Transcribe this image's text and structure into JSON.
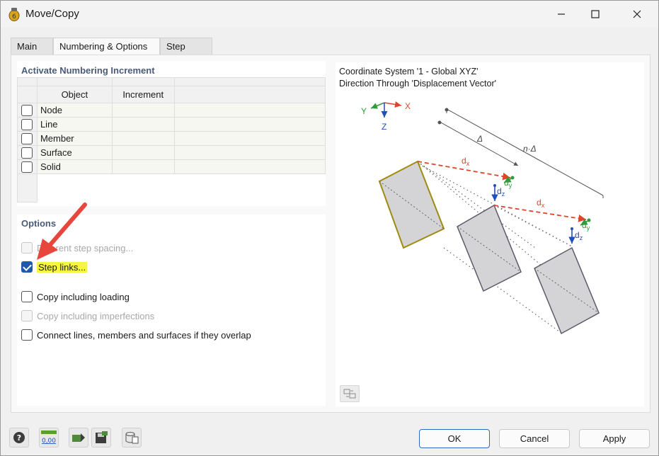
{
  "window": {
    "title": "Move/Copy"
  },
  "tabs": [
    {
      "label": "Main"
    },
    {
      "label": "Numbering & Options"
    },
    {
      "label": "Step Links"
    }
  ],
  "numbering": {
    "title": "Activate Numbering Increment",
    "headers": {
      "object": "Object",
      "increment": "Increment"
    },
    "rows": [
      {
        "label": "Node",
        "checked": false
      },
      {
        "label": "Line",
        "checked": false
      },
      {
        "label": "Member",
        "checked": false
      },
      {
        "label": "Surface",
        "checked": false
      },
      {
        "label": "Solid",
        "checked": false
      }
    ]
  },
  "options": {
    "title": "Options",
    "items": [
      {
        "label": "Different step spacing...",
        "checked": false,
        "disabled": true
      },
      {
        "label": "Step links...",
        "checked": true,
        "disabled": false,
        "highlighted": true
      },
      {
        "label": "Copy including loading",
        "checked": false,
        "disabled": false
      },
      {
        "label": "Copy including imperfections",
        "checked": false,
        "disabled": true
      },
      {
        "label": "Connect lines, members and surfaces if they overlap",
        "checked": false,
        "disabled": false
      }
    ]
  },
  "preview": {
    "line1": "Coordinate System '1 - Global XYZ'",
    "line2": "Direction Through 'Displacement Vector'",
    "axes": {
      "x": "X",
      "y": "Y",
      "z": "Z"
    },
    "labels": {
      "delta": "Δ",
      "n_delta": "n·Δ",
      "dx": "d",
      "dy": "d",
      "dz": "d",
      "sub_x": "x",
      "sub_y": "y",
      "sub_z": "z"
    },
    "colors": {
      "x_axis": "#e0452b",
      "y_axis": "#2e9c3c",
      "z_axis": "#1f4fb8",
      "accent": "#c9a227"
    }
  },
  "footer": {
    "tools": [
      "help-icon",
      "units-icon",
      "export-icon",
      "save-icon",
      "database-icon"
    ],
    "units_text": "0,00",
    "ok": "OK",
    "cancel": "Cancel",
    "apply": "Apply"
  }
}
